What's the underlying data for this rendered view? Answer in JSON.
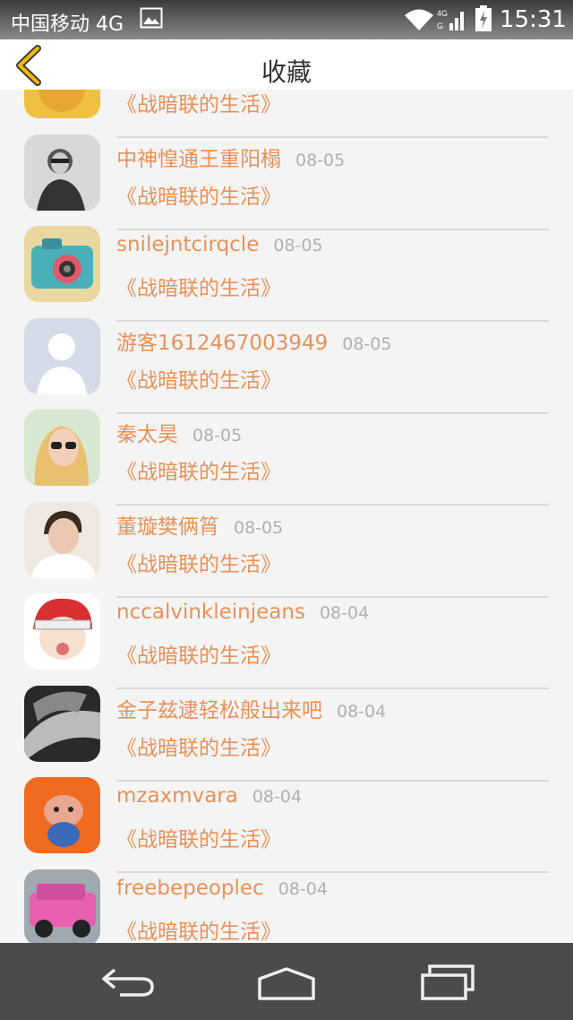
{
  "status_bar": {
    "carrier": "中国移动 4G",
    "time": "15:31",
    "icons": [
      "image-icon",
      "wifi-icon",
      "signal-4g-icon",
      "battery-charging-icon"
    ]
  },
  "header": {
    "title": "收藏",
    "back_icon": "chevron-left-icon",
    "accent": "#f0b800"
  },
  "list": {
    "items": [
      {
        "name": "",
        "date": "",
        "book": "《战暗联的生活》",
        "avatar": "cartoon-yellow"
      },
      {
        "name": "中神惶通王重阳榻",
        "date": "08-05",
        "book": "《战暗联的生活》",
        "avatar": "bw-portrait"
      },
      {
        "name": "snilejntcirqcle",
        "date": "08-05",
        "book": "《战暗联的生活》",
        "avatar": "camera"
      },
      {
        "name": "游客1612467003949",
        "date": "08-05",
        "book": "《战暗联的生活》",
        "avatar": "default-person"
      },
      {
        "name": "秦太昊",
        "date": "08-05",
        "book": "《战暗联的生活》",
        "avatar": "blonde-sunglasses"
      },
      {
        "name": "董璇樊俩筲",
        "date": "08-05",
        "book": "《战暗联的生活》",
        "avatar": "young-man"
      },
      {
        "name": "nccalvinkleinjeans",
        "date": "08-04",
        "book": "《战暗联的生活》",
        "avatar": "cartoon-redhead"
      },
      {
        "name": "金子兹逮轻松般出来吧",
        "date": "08-04",
        "book": "《战暗联的生活》",
        "avatar": "bw-face"
      },
      {
        "name": "mzaxmvara",
        "date": "08-04",
        "book": "《战暗联的生活》",
        "avatar": "cartoon-orange"
      },
      {
        "name": "freebepeoplec",
        "date": "08-04",
        "book": "《战暗联的生活》",
        "avatar": "pink-jeep"
      }
    ]
  },
  "nav_bar": {
    "icons": [
      "nav-back-icon",
      "nav-home-icon",
      "nav-recent-apps-icon"
    ]
  },
  "colors": {
    "name_text": "#e5925a",
    "date_text": "#b0b0b0",
    "background": "#f4f4f4",
    "nav_bar": "#4b4b4b"
  }
}
